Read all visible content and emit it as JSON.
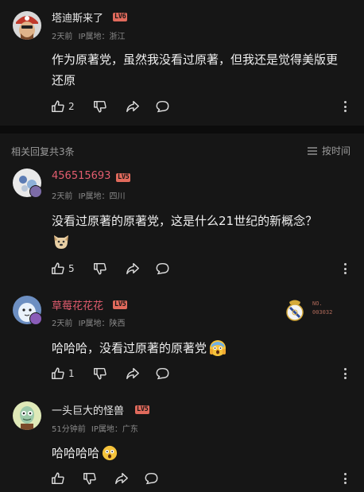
{
  "main_comment": {
    "user": "塔迪斯来了",
    "level": "LV6",
    "time": "2天前",
    "location": "IP属地：浙江",
    "text": "作为原著党，虽然我没看过原著，但我还是觉得美版更还原",
    "likes": "2"
  },
  "replies_header": {
    "title": "相关回复共3条",
    "sort_label": "按时间"
  },
  "replies": [
    {
      "user": "456515693",
      "level": "LV5",
      "time": "2天前",
      "location": "IP属地：四川",
      "text": "没看过原著的原著党，这是什么21世纪的新概念？",
      "likes": "5",
      "name_color": "#e35d6f"
    },
    {
      "user": "草莓花花花",
      "level": "LV5",
      "time": "2天前",
      "location": "IP属地：陕西",
      "text": "哈哈哈，没看过原著的原著党",
      "likes": "1",
      "name_color": "#e35d6f",
      "badge_text": "NO.\n003032"
    },
    {
      "user": "一头巨大的怪兽",
      "level": "LV5",
      "time": "51分钟前",
      "location": "IP属地：广东",
      "text": "哈哈哈哈",
      "likes": "",
      "name_color": "#e8e8e8"
    }
  ]
}
